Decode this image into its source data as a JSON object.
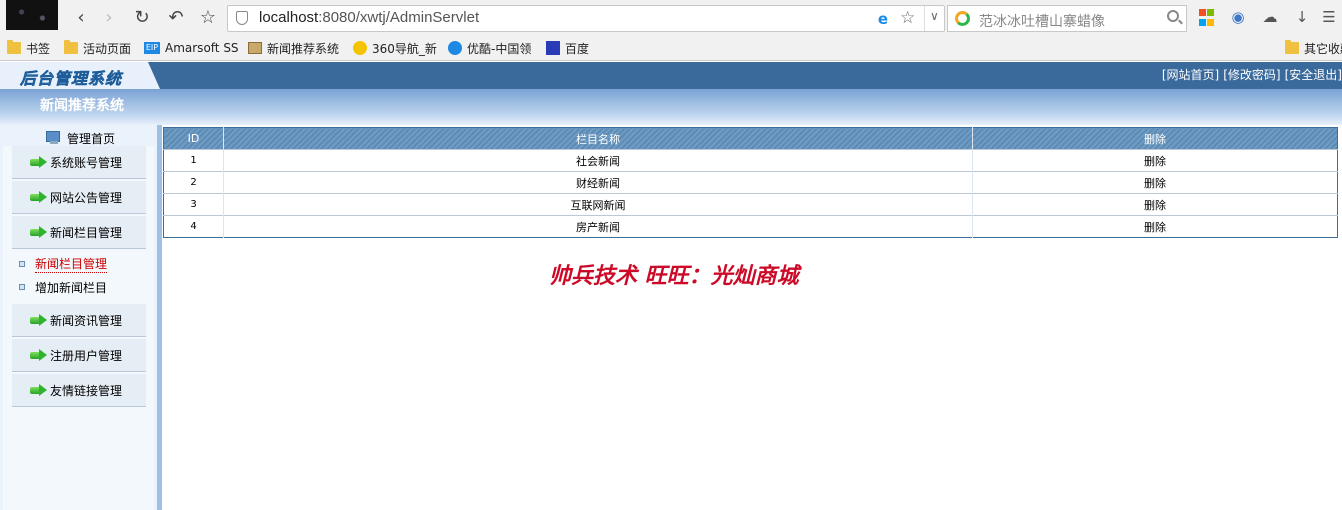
{
  "browser": {
    "url_host": "localhost",
    "url_path": ":8080/xwtj/AdminServlet",
    "search_placeholder": "范冰冰吐槽山寨蜡像",
    "bookmarks": [
      "书签",
      "活动页面",
      "Amarsoft SS",
      "新闻推荐系统",
      "360导航_新",
      "优酷-中国领",
      "百度"
    ],
    "bookmark_other": "其它收藏"
  },
  "header": {
    "logo": "后台管理系统",
    "links": [
      "[网站首页]",
      "[修改密码]",
      "[安全退出]"
    ],
    "system_title": "新闻推荐系统"
  },
  "sidebar": {
    "home": "管理首页",
    "menus": [
      "系统账号管理",
      "网站公告管理",
      "新闻栏目管理"
    ],
    "submenus": [
      "新闻栏目管理",
      "增加新闻栏目"
    ],
    "menus_after": [
      "新闻资讯管理",
      "注册用户管理",
      "友情链接管理"
    ]
  },
  "table": {
    "headers": [
      "ID",
      "栏目名称",
      "删除"
    ],
    "rows": [
      {
        "id": "1",
        "name": "社会新闻",
        "action": "删除"
      },
      {
        "id": "2",
        "name": "财经新闻",
        "action": "删除"
      },
      {
        "id": "3",
        "name": "互联网新闻",
        "action": "删除"
      },
      {
        "id": "4",
        "name": "房产新闻",
        "action": "删除"
      }
    ]
  },
  "slogan": "帅兵技术 旺旺：光灿商城",
  "colors": {
    "header_bar": "#3a6a9c",
    "slogan": "#cc0a28",
    "active_submenu": "#cc0000"
  }
}
